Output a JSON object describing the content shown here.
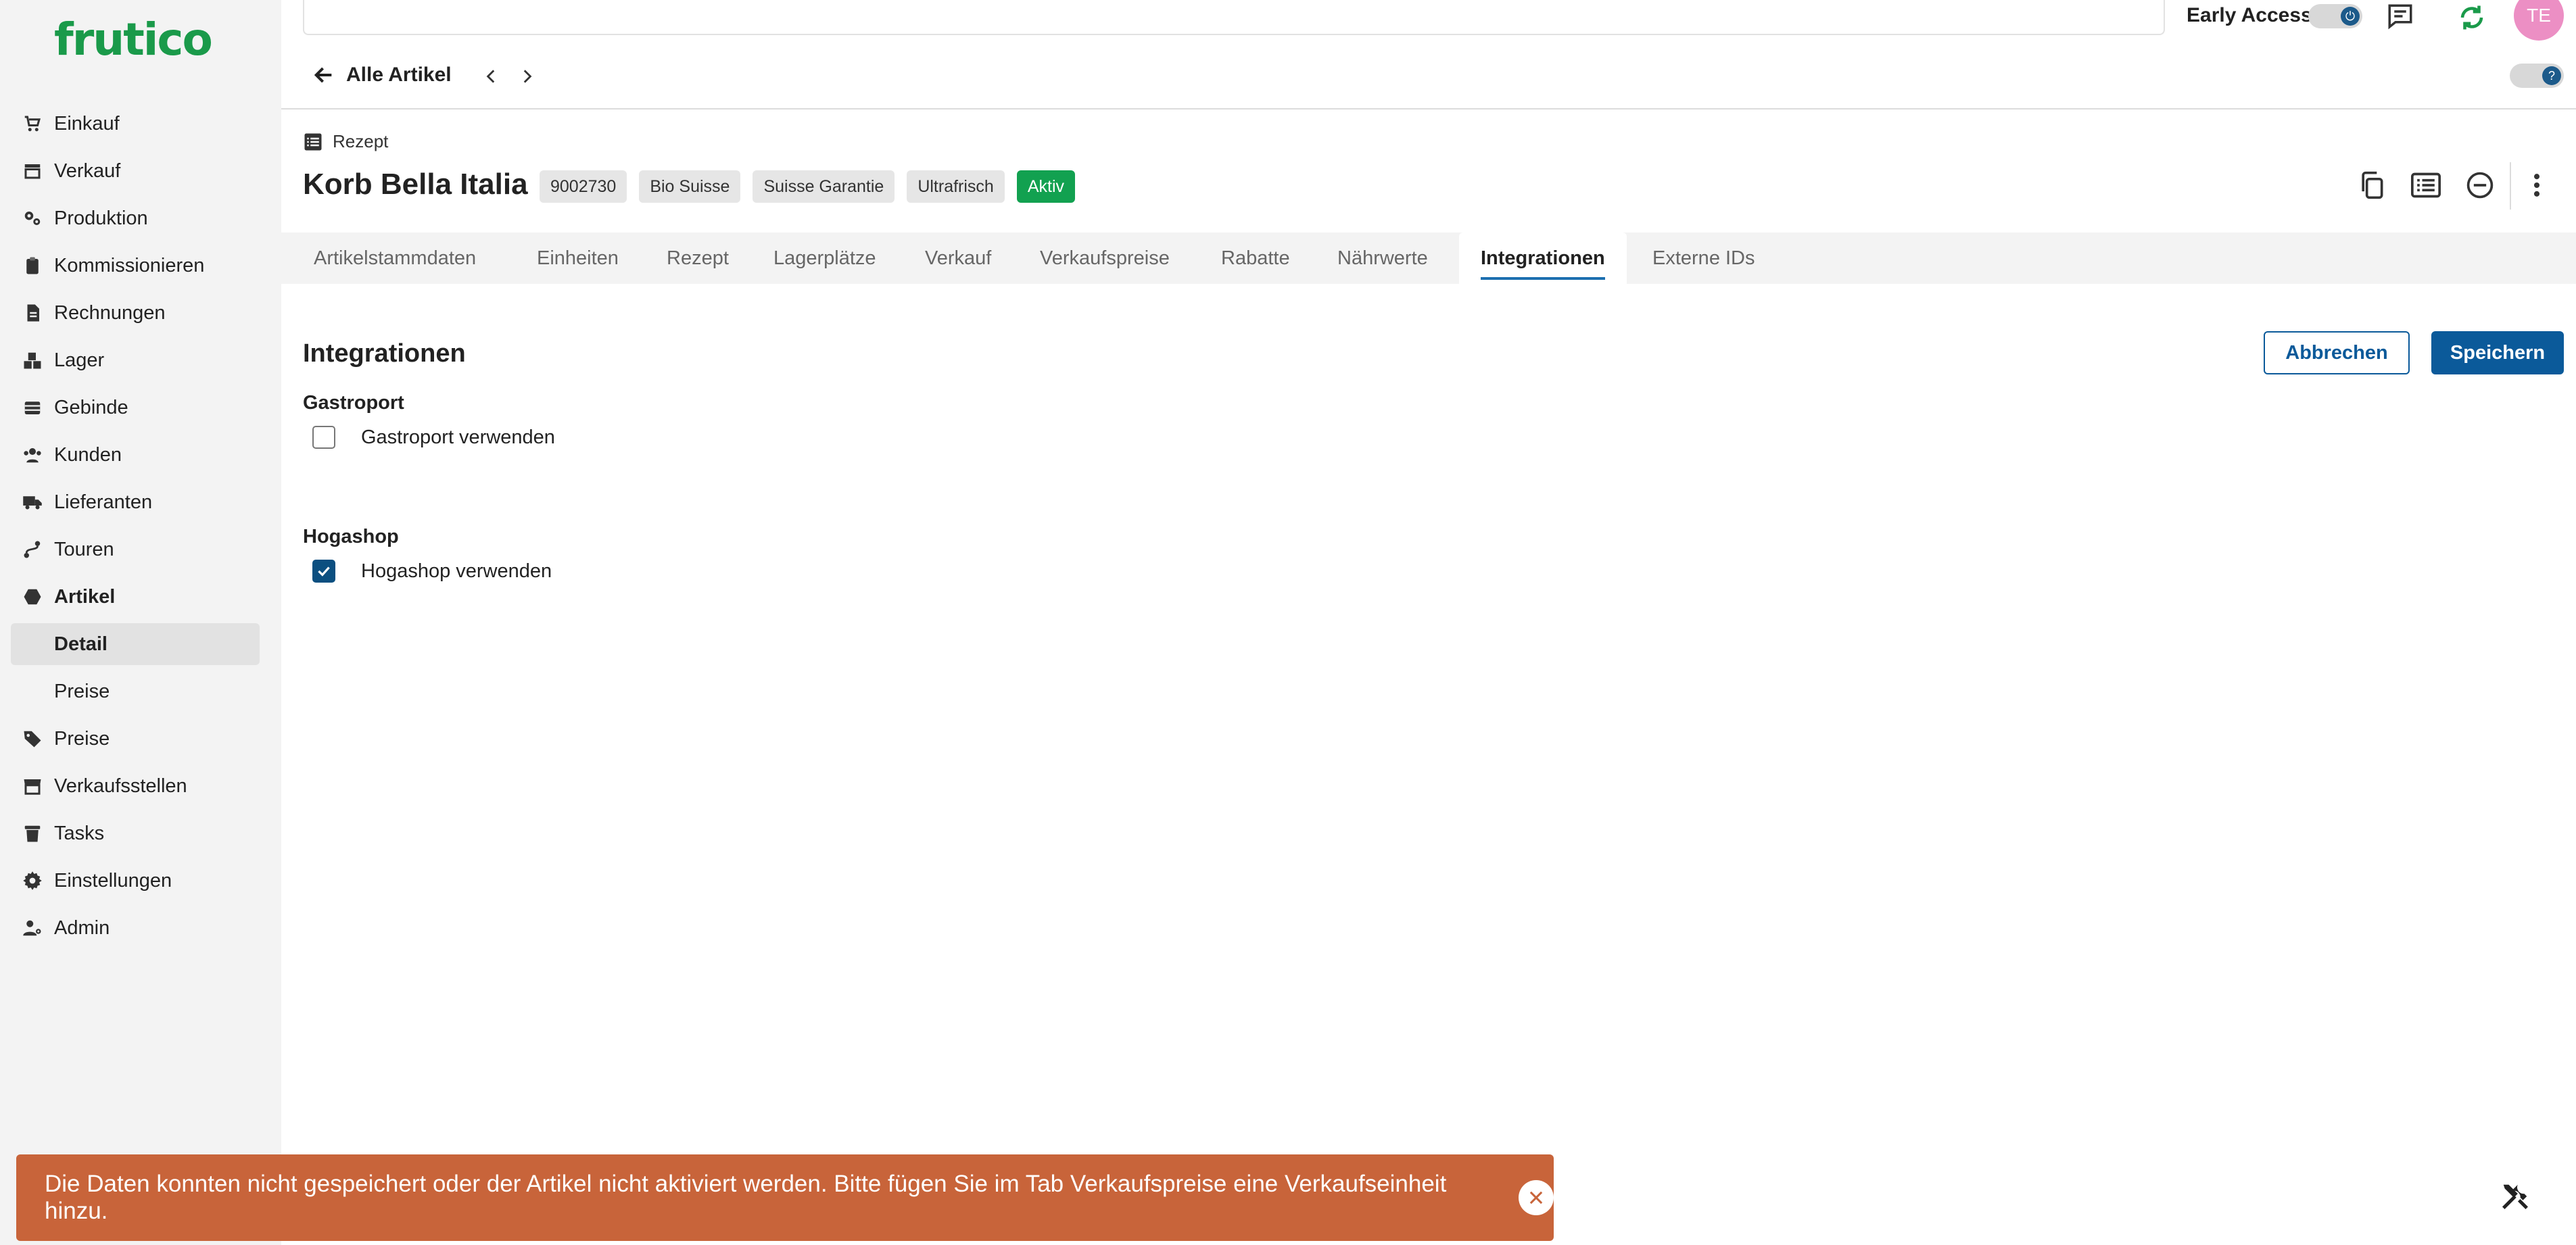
{
  "app": {
    "logo": "frutico"
  },
  "sidebar": {
    "items": [
      {
        "label": "Einkauf",
        "icon": "cart-icon"
      },
      {
        "label": "Verkauf",
        "icon": "store-icon"
      },
      {
        "label": "Produktion",
        "icon": "gears-icon"
      },
      {
        "label": "Kommissionieren",
        "icon": "clipboard-icon"
      },
      {
        "label": "Rechnungen",
        "icon": "invoice-icon"
      },
      {
        "label": "Lager",
        "icon": "boxes-icon"
      },
      {
        "label": "Gebinde",
        "icon": "crate-icon"
      },
      {
        "label": "Kunden",
        "icon": "users-icon"
      },
      {
        "label": "Lieferanten",
        "icon": "truck-icon"
      },
      {
        "label": "Touren",
        "icon": "route-icon"
      },
      {
        "label": "Artikel",
        "icon": "hexagon-icon"
      },
      {
        "label": "Detail"
      },
      {
        "label": "Preise"
      },
      {
        "label": "Preise",
        "icon": "tags-icon"
      },
      {
        "label": "Verkaufsstellen",
        "icon": "shop-icon"
      },
      {
        "label": "Tasks",
        "icon": "trash-icon"
      },
      {
        "label": "Einstellungen",
        "icon": "gear-icon"
      },
      {
        "label": "Admin",
        "icon": "user-gear-icon"
      }
    ]
  },
  "topbar": {
    "early_access_label": "Early Access",
    "avatar_initials": "TE"
  },
  "nav": {
    "back_label": "Alle Artikel"
  },
  "header": {
    "type_label": "Rezept",
    "title": "Korb Bella Italia",
    "badges": [
      "9002730",
      "Bio Suisse",
      "Suisse Garantie",
      "Ultrafrisch",
      "Aktiv"
    ]
  },
  "tabs": [
    "Artikelstammdaten",
    "Einheiten",
    "Rezept",
    "Lagerplätze",
    "Verkauf",
    "Verkaufspreise",
    "Rabatte",
    "Nährwerte",
    "Integrationen",
    "Externe IDs"
  ],
  "active_tab": "Integrationen",
  "content": {
    "section_title": "Integrationen",
    "cancel_label": "Abbrechen",
    "save_label": "Speichern",
    "groups": [
      {
        "label": "Gastroport",
        "checkbox_label": "Gastroport verwenden",
        "checked": false
      },
      {
        "label": "Hogashop",
        "checkbox_label": "Hogashop verwenden",
        "checked": true
      }
    ]
  },
  "toast": {
    "message": "Die Daten konnten nicht gespeichert oder der Artikel nicht aktiviert werden. Bitte fügen Sie im Tab Verkaufspreise eine Verkaufseinheit hinzu."
  },
  "colors": {
    "brand": "#1a9a4a",
    "primary": "#0b5a9a",
    "toast": "#c8643a",
    "active_badge": "#12a150"
  }
}
